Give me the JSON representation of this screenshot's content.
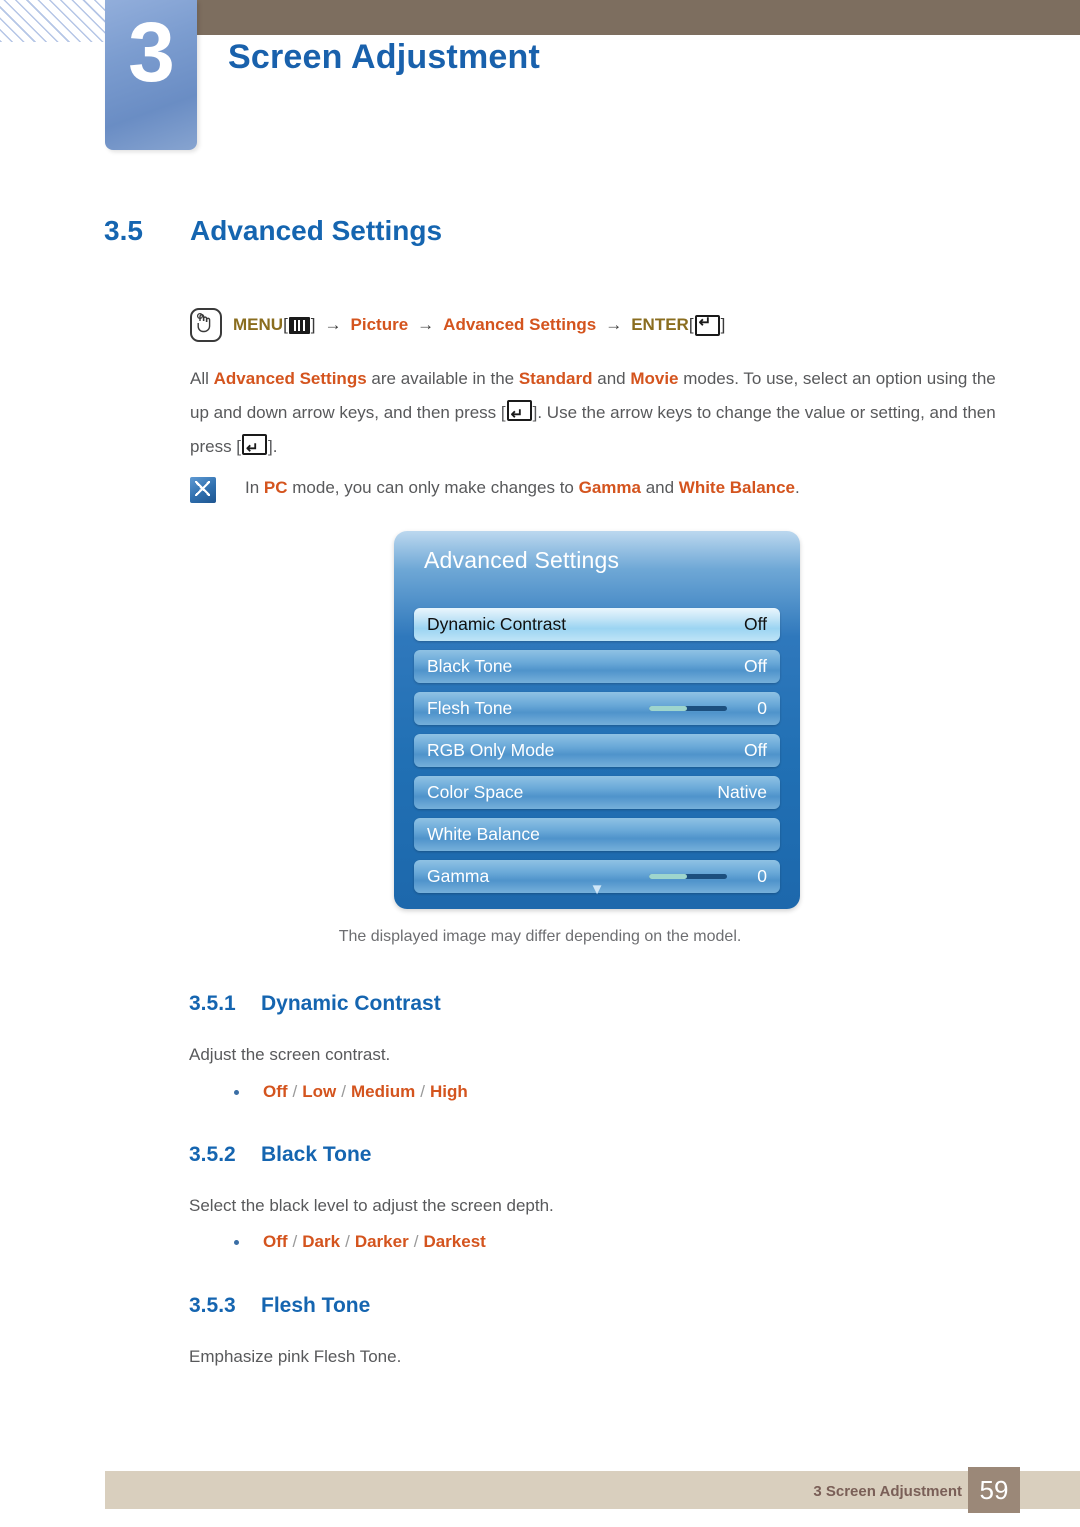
{
  "header": {
    "chapter_number": "3",
    "chapter_title": "Screen Adjustment"
  },
  "section": {
    "number": "3.5",
    "title": "Advanced Settings"
  },
  "breadcrumb": {
    "hand_icon": "hand-press-icon",
    "menu_label": "MENU",
    "menu_glyph": "menu-bars-icon",
    "arrow": "→",
    "picture_label": "Picture",
    "advanced_label": "Advanced Settings",
    "enter_label": "ENTER",
    "enter_glyph": "enter-key-icon",
    "open_bracket": "[",
    "close_bracket": "]"
  },
  "body": {
    "p1_a": "All ",
    "p1_hl1": "Advanced Settings",
    "p1_b": " are available in the ",
    "p1_hl2": "Standard",
    "p1_c": " and ",
    "p1_hl3": "Movie",
    "p1_d": " modes. To use, select an option using the up and down arrow keys, and then press [",
    "p1_e": "]. Use the arrow keys to change the value or setting, and then press [",
    "p1_f": "]."
  },
  "note": {
    "icon": "note-pencil-icon",
    "a": "In ",
    "hl1": "PC",
    "b": " mode, you can only make changes to ",
    "hl2": "Gamma",
    "c": " and ",
    "hl3": "White Balance",
    "d": "."
  },
  "osd": {
    "title": "Advanced Settings",
    "more_indicator": "▼",
    "rows": [
      {
        "label": "Dynamic Contrast",
        "value": "Off",
        "type": "value",
        "selected": true
      },
      {
        "label": "Black Tone",
        "value": "Off",
        "type": "value",
        "selected": false
      },
      {
        "label": "Flesh Tone",
        "value": "0",
        "type": "slider",
        "selected": false
      },
      {
        "label": "RGB Only Mode",
        "value": "Off",
        "type": "value",
        "selected": false
      },
      {
        "label": "Color Space",
        "value": "Native",
        "type": "value",
        "selected": false
      },
      {
        "label": "White Balance",
        "value": "",
        "type": "none",
        "selected": false
      },
      {
        "label": "Gamma",
        "value": "0",
        "type": "slider",
        "selected": false
      }
    ],
    "caption": "The displayed image may differ depending on the model."
  },
  "subsections": [
    {
      "number": "3.5.1",
      "title": "Dynamic Contrast",
      "description": "Adjust the screen contrast.",
      "options": [
        "Off",
        "Low",
        "Medium",
        "High"
      ]
    },
    {
      "number": "3.5.2",
      "title": "Black Tone",
      "description": "Select the black level to adjust the screen depth.",
      "options": [
        "Off",
        "Dark",
        "Darker",
        "Darkest"
      ]
    },
    {
      "number": "3.5.3",
      "title": "Flesh Tone",
      "description": "Emphasize pink Flesh Tone.",
      "options": []
    }
  ],
  "footer": {
    "text": "3 Screen Adjustment",
    "page": "59"
  },
  "colors": {
    "heading_blue": "#1565b0",
    "accent_orange": "#d4541e",
    "menu_gold": "#8a6d1f",
    "brown_bar": "#7d6e5f",
    "footer_tan": "#d9cfbe",
    "footer_page_box": "#9b8878",
    "body_gray": "#58595b"
  }
}
